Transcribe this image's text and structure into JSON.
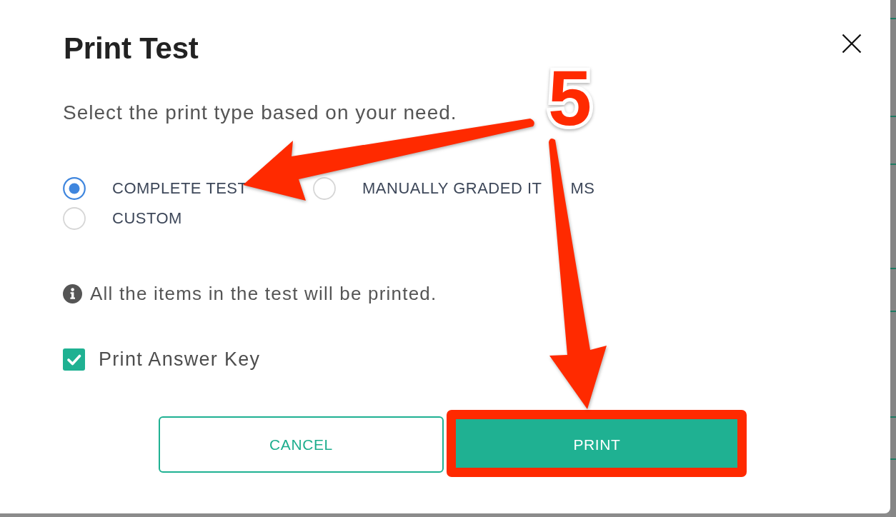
{
  "dialog": {
    "title": "Print Test",
    "instruction": "Select the print type based on your need.",
    "print_types": [
      {
        "label": "COMPLETE TEST",
        "selected": true
      },
      {
        "label": "MANUALLY GRADED IT",
        "label_continued": "MS",
        "selected": false
      },
      {
        "label": "CUSTOM",
        "selected": false
      }
    ],
    "note": "All the items in the test will be printed.",
    "answer_key": {
      "label": "Print Answer Key",
      "checked": true
    },
    "buttons": [
      {
        "label": "CANCEL",
        "kind": "secondary",
        "highlighted": false
      },
      {
        "label": "PRINT",
        "kind": "primary",
        "highlighted": true
      }
    ]
  },
  "annotation": {
    "step_number": "5"
  }
}
